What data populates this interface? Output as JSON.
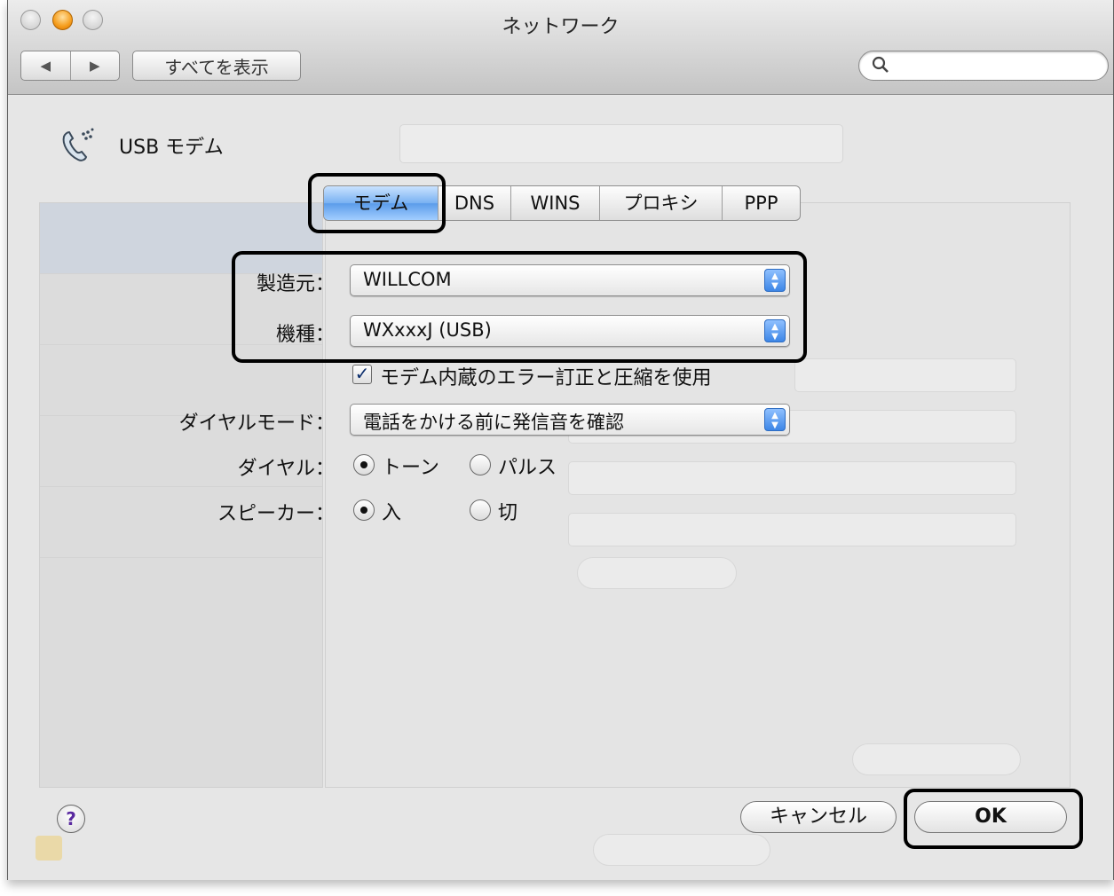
{
  "window": {
    "title": "ネットワーク",
    "nav_back": "◀",
    "nav_forward": "▶",
    "show_all_label": "すべてを表示",
    "search_placeholder": ""
  },
  "sheet": {
    "service_name": "USB モデム",
    "tabs": [
      "モデム",
      "DNS",
      "WINS",
      "プロキシ",
      "PPP"
    ],
    "active_tab": "モデム",
    "vendor": {
      "label": "製造元：",
      "value": "WILLCOM"
    },
    "model": {
      "label": "機種：",
      "value": "WXxxxJ (USB)"
    },
    "error_correction": {
      "checked": true,
      "label": "モデム内蔵のエラー訂正と圧縮を使用"
    },
    "dial_mode": {
      "label": "ダイヤルモード：",
      "value": "電話をかける前に発信音を確認"
    },
    "dialing": {
      "label": "ダイヤル：",
      "options": [
        "トーン",
        "パルス"
      ],
      "selected": "トーン"
    },
    "speaker": {
      "label": "スピーカー：",
      "options": [
        "入",
        "切"
      ],
      "selected": "入"
    },
    "help_label": "?",
    "cancel_label": "キャンセル",
    "ok_label": "OK"
  },
  "icons": {
    "search": "search-icon",
    "phone_modem": "modem-phone-icon",
    "popup_arrows": "popup-arrows-icon"
  },
  "colors": {
    "active_tab": "#79b1f2",
    "popup_arrows": "#3d86e6",
    "highlight_box": "#000000"
  }
}
